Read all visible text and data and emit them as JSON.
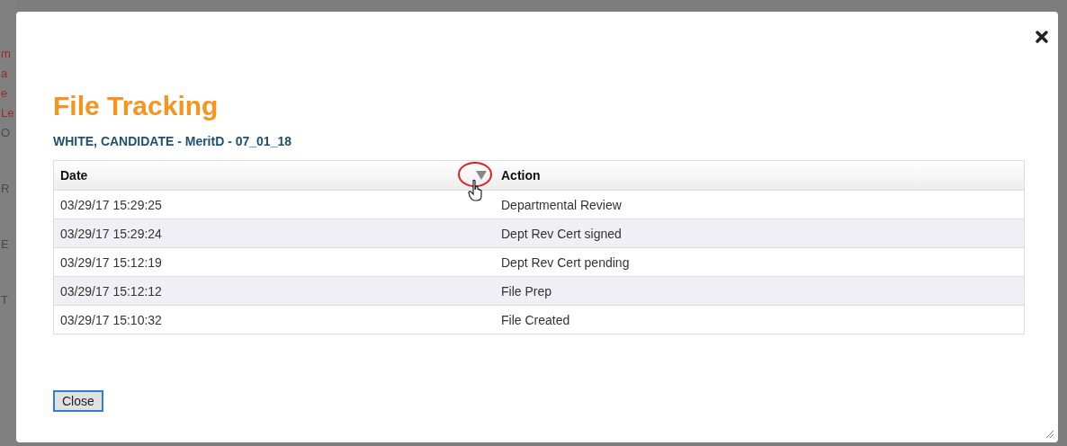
{
  "background_fragments": [
    {
      "text": "m",
      "kind": "link"
    },
    {
      "text": "a",
      "kind": "link"
    },
    {
      "text": "e",
      "kind": "link"
    },
    {
      "text": "Le",
      "kind": "link"
    },
    {
      "text": "O",
      "kind": "plain"
    },
    {
      "text": "R",
      "kind": "plain"
    },
    {
      "text": "E",
      "kind": "plain"
    },
    {
      "text": "T",
      "kind": "plain"
    }
  ],
  "dialog": {
    "title": "File Tracking",
    "subtitle": "WHITE, CANDIDATE - MeritD - 07_01_18",
    "table": {
      "columns": [
        {
          "label": "Date"
        },
        {
          "label": "Action"
        }
      ],
      "rows": [
        [
          "03/29/17 15:29:25",
          "Departmental Review"
        ],
        [
          "03/29/17 15:29:24",
          "Dept Rev Cert signed"
        ],
        [
          "03/29/17 15:12:19",
          "Dept Rev Cert pending"
        ],
        [
          "03/29/17 15:12:12",
          "File Prep"
        ],
        [
          "03/29/17 15:10:32",
          "File Created"
        ]
      ]
    },
    "close_button": "Close"
  }
}
